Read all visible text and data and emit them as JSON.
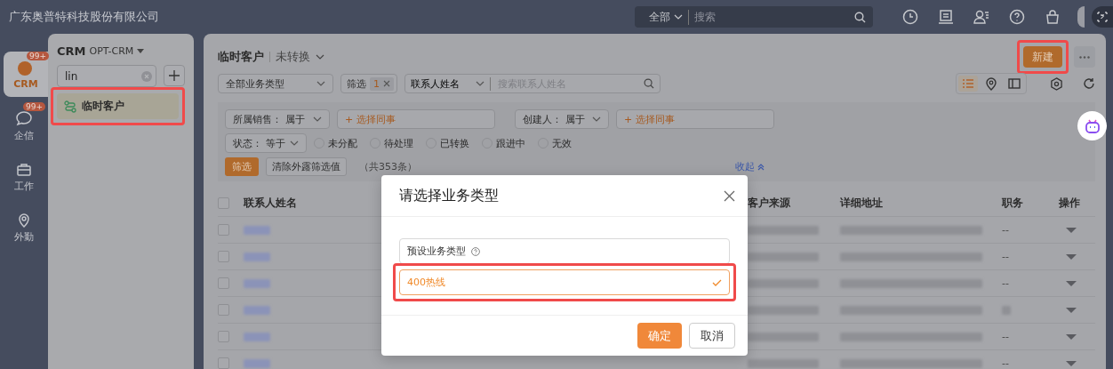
{
  "top_bar": {
    "company": "广东奥普特科技股份有限公司",
    "search_scope": "全部",
    "search_placeholder": "搜索"
  },
  "rail": [
    {
      "label": "CRM",
      "badge": "99+",
      "selected": true,
      "kind": "crm"
    },
    {
      "label": "企信",
      "badge": "99+",
      "selected": false,
      "kind": "chat"
    },
    {
      "label": "工作",
      "selected": false,
      "kind": "work"
    },
    {
      "label": "外勤",
      "selected": false,
      "kind": "location"
    }
  ],
  "sidebar": {
    "app": "CRM",
    "app_sub": "OPT-CRM",
    "search_value": "lin",
    "items": [
      {
        "label": "临时客户",
        "selected": true,
        "highlighted": true
      }
    ]
  },
  "main": {
    "title": "临时客户",
    "view": "未转换",
    "new_button": {
      "label": "新建",
      "highlighted": true
    },
    "type_select": "全部业务类型",
    "filter_chip": {
      "label": "筛选",
      "count": "1"
    },
    "search_field": "联系人姓名",
    "search_placeholder": "搜索联系人姓名",
    "view_modes": [
      {
        "kind": "list",
        "selected": true
      },
      {
        "kind": "map",
        "selected": false
      },
      {
        "kind": "split",
        "selected": false
      }
    ],
    "filters": [
      {
        "field": "所属销售：",
        "op": "属于",
        "placeholder": "+ 选择同事"
      },
      {
        "field": "创建人：",
        "op": "属于",
        "placeholder": "+ 选择同事"
      }
    ],
    "status_filter": {
      "field": "状态：",
      "op": "等于",
      "options": [
        {
          "label": "未分配",
          "checked": false
        },
        {
          "label": "待处理",
          "checked": false
        },
        {
          "label": "已转换",
          "checked": false
        },
        {
          "label": "跟进中",
          "checked": false
        },
        {
          "label": "无效",
          "checked": false
        }
      ]
    },
    "filter_button": "筛选",
    "clear_button": "清除外露筛选值",
    "total": "（共353条）",
    "collapse": "收起"
  },
  "table": {
    "columns": [
      "联系人姓名",
      "客户来源",
      "详细地址",
      "职务",
      "操作"
    ],
    "select_all_checked": false,
    "rows": [
      {
        "checked": false,
        "job": "--"
      },
      {
        "checked": false,
        "job": "--"
      },
      {
        "checked": false,
        "job": "--"
      },
      {
        "checked": false
      },
      {
        "checked": false,
        "job": "--"
      },
      {
        "checked": false,
        "job": "--"
      }
    ]
  },
  "dialog": {
    "title": "请选择业务类型",
    "options": [
      {
        "label": "预设业务类型",
        "help": true,
        "selected": false,
        "highlighted": false
      },
      {
        "label": "400热线",
        "selected": true,
        "highlighted": true
      }
    ],
    "buttons": [
      {
        "label": "确定",
        "kind": "primary"
      },
      {
        "label": "取消",
        "kind": "default"
      }
    ]
  }
}
